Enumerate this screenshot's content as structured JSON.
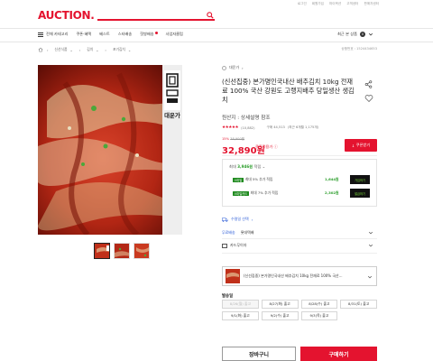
{
  "util_links": [
    "로그인",
    "회원가입",
    "마이옥션",
    "고객센터",
    "판매자센터"
  ],
  "header": {
    "logo": "AUCTION.",
    "search_placeholder": ""
  },
  "nav": {
    "menu_label": "전체 카테고리",
    "items": [
      "쿠폰·혜택",
      "베스트",
      "스타배송",
      "핫쌍배송",
      "사업자클럽"
    ],
    "recent_label": "최근 본 상품",
    "recent_count": "0"
  },
  "breadcrumb": {
    "items": [
      "신선식품",
      "김치",
      "포기김치"
    ]
  },
  "product_number": "상품번호 : 1524434653",
  "thumbnail_count": 3,
  "product": {
    "store": "대운가",
    "title": "(신선집중) 본가명인국내산 배추김치 10kg 전재료 100% 국산 강원도 고랭지배추 당일생산 생김치",
    "origin": "원산지 : 상세설명 참조",
    "stars": "★★★★★",
    "review_count": "(10,882)",
    "sales": "구매 44,513",
    "sales_note": "(최근 6개월 1,175개)",
    "discount": "15%",
    "original_price": "38,900원",
    "price": "32,890원",
    "coupon_text": "쿠폰적용가",
    "coupon_button": "쿠폰받기"
  },
  "points": {
    "header_prefix": "최대",
    "header_amount": "3,946원",
    "header_suffix": "적립",
    "rows": [
      {
        "badge": "스마일",
        "text": "최대 5% 추가 적립",
        "amount": "1,644원",
        "button": "가입하기"
      },
      {
        "badge": "스마일카드",
        "text": "최대 7% 추가 적립",
        "amount": "2,302원",
        "button": "발급하기"
      }
    ]
  },
  "delivery": {
    "ship_label": "수령일 선택",
    "d1_label": "무료배송",
    "d1_value": "롯데택배",
    "d2_value": "카드무이자"
  },
  "option": {
    "text": "(신선집중) 본가명인국내산 배추김치 10kg 전재료 100% 국산..."
  },
  "ship_date": {
    "title": "발송일",
    "dates": [
      {
        "label": "8/26(월) 출고",
        "disabled": true
      },
      {
        "label": "8/27(화) 출고",
        "disabled": false
      },
      {
        "label": "8/28(수) 출고",
        "disabled": false
      },
      {
        "label": "8/31(토) 출고",
        "disabled": false
      },
      {
        "label": "9/1(화) 출고",
        "disabled": false
      },
      {
        "label": "9/2(수) 출고",
        "disabled": false
      },
      {
        "label": "9/3(목) 출고",
        "disabled": false
      }
    ]
  },
  "buttons": {
    "cart": "장바구니",
    "buy": "구매하기"
  },
  "colors": {
    "brand": "#e4132f",
    "points_green": "#2a9d2a",
    "link_blue": "#2a5bd7"
  }
}
